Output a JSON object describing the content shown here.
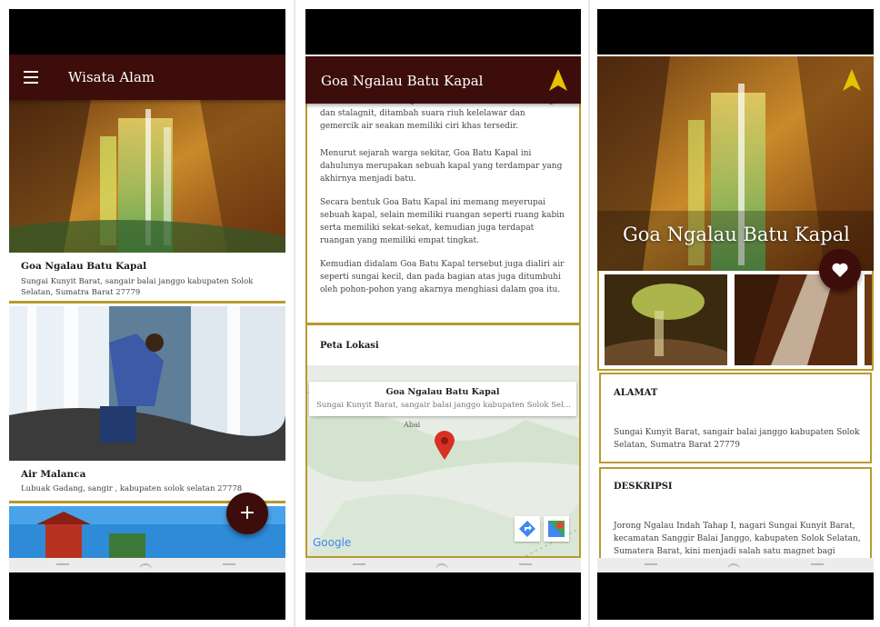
{
  "screen1": {
    "app_title": "Wisata Alam",
    "cards": [
      {
        "title": "Goa Ngalau Batu Kapal",
        "address": "Sungai Kunyit Barat, sangair balai janggo kabupaten Solok Selatan, Sumatra Barat 27779"
      },
      {
        "title": "Air Malanca",
        "address": "Lubuak Gadang, sangir , kabupaten solok selatan 27778"
      }
    ],
    "fab_label": "+"
  },
  "screen2": {
    "title": "Goa Ngalau Batu Kapal",
    "paragraphs": [
      "Keasrian Goa Batu Kapal ini terlihat dari susunan stalagit dan stalagnit, ditambah suara riuh kelelawar dan gemercik air seakan memiliki ciri khas tersedir.",
      "Menurut sejarah warga sekitar, Goa Batu Kapal ini dahulunya merupakan sebuah kapal yang terdampar yang akhirnya menjadi batu.",
      "Secara bentuk Goa Batu Kapal ini memang meyerupai sebuah kapal, selain memiliki ruangan seperti ruang kabin serta memiliki sekat-sekat, kemudian juga terdapat ruangan yang memiliki empat tingkat.",
      "Kemudian didalam Goa Batu Kapal tersebut juga dialiri air seperti sungai kecil, dan pada bagian atas juga ditumbuhi oleh pohon-pohon yang akarnya menghiasi dalam goa itu."
    ],
    "map_section_title": "Peta Lokasi",
    "map_popup_title": "Goa Ngalau Batu Kapal",
    "map_popup_sub": "Sungai Kunyit Barat, sangair balai janggo kabupaten Solok Sel...",
    "map_place_label": "Abai",
    "google_logo": "Google"
  },
  "screen3": {
    "hero_title": "Goa Ngalau Batu Kapal",
    "alamat_title": "ALAMAT",
    "alamat_text": "Sungai Kunyit Barat, sangair balai janggo kabupaten Solok Selatan, Sumatra Barat 27779",
    "deskripsi_title": "DESKRIPSI",
    "deskripsi_text": "Jorong Ngalau Indah Tahap I, nagari Sungai Kunyit Barat, kecamatan Sanggir Balai Janggo, kabupaten Solok Selatan, Sumatera Barat, kini menjadi salah satu magnet bagi"
  },
  "colors": {
    "appbar": "#3c0d0a",
    "accent": "#b89a2e",
    "nav_arrow": "#e6c200",
    "pin": "#d93025"
  },
  "icons": [
    "menu-icon",
    "navigation-arrow-icon",
    "add-icon",
    "heart-icon",
    "map-pin-icon",
    "directions-icon",
    "google-maps-icon",
    "back-icon",
    "home-icon",
    "recents-icon"
  ]
}
